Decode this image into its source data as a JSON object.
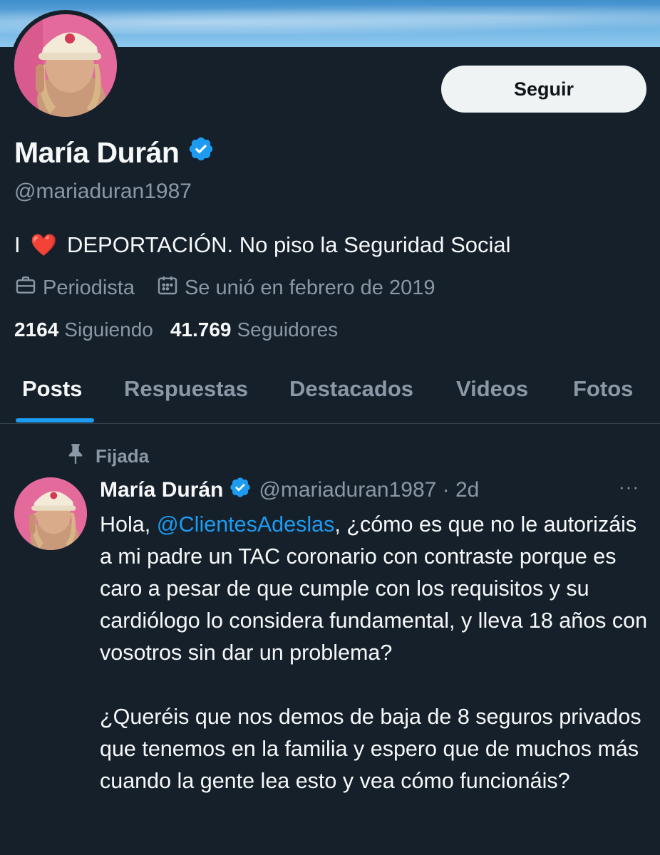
{
  "profile": {
    "name": "María Durán",
    "handle": "@mariaduran1987",
    "bio_prefix": "I",
    "bio_heart": "❤️",
    "bio_text": "DEPORTACIÓN. No piso la Seguridad Social",
    "occupation": "Periodista",
    "joined": "Se unió en febrero de 2019",
    "following_count": "2164",
    "following_label": "Siguiendo",
    "followers_count": "41.769",
    "followers_label": "Seguidores",
    "follow_button": "Seguir",
    "verified_icon": "verified-badge-icon"
  },
  "tabs": [
    {
      "label": "Posts",
      "active": true
    },
    {
      "label": "Respuestas",
      "active": false
    },
    {
      "label": "Destacados",
      "active": false
    },
    {
      "label": "Videos",
      "active": false
    },
    {
      "label": "Fotos",
      "active": false
    }
  ],
  "post": {
    "pinned_label": "Fijada",
    "author": "María Durán",
    "handle_time": "@mariaduran1987 · 2d",
    "more": "···",
    "text_before_mention": "Hola, ",
    "mention": "@ClientesAdeslas",
    "text_after_mention": ", ¿cómo es que no le autorizáis a mi padre un TAC coronario con contraste porque es caro a pesar de que cumple con los requisitos y su cardiólogo lo considera fundamental, y lleva 18 años con vosotros sin dar un problema?",
    "paragraph2": "¿Queréis que nos demos de baja de 8 seguros privados que tenemos en la familia y espero que de muchos más cuando la gente lea esto y vea cómo funcionáis?"
  },
  "colors": {
    "background": "#15202b",
    "accent": "#1d9bf0",
    "muted": "#8b98a5",
    "verified": "#1d9bf0"
  }
}
